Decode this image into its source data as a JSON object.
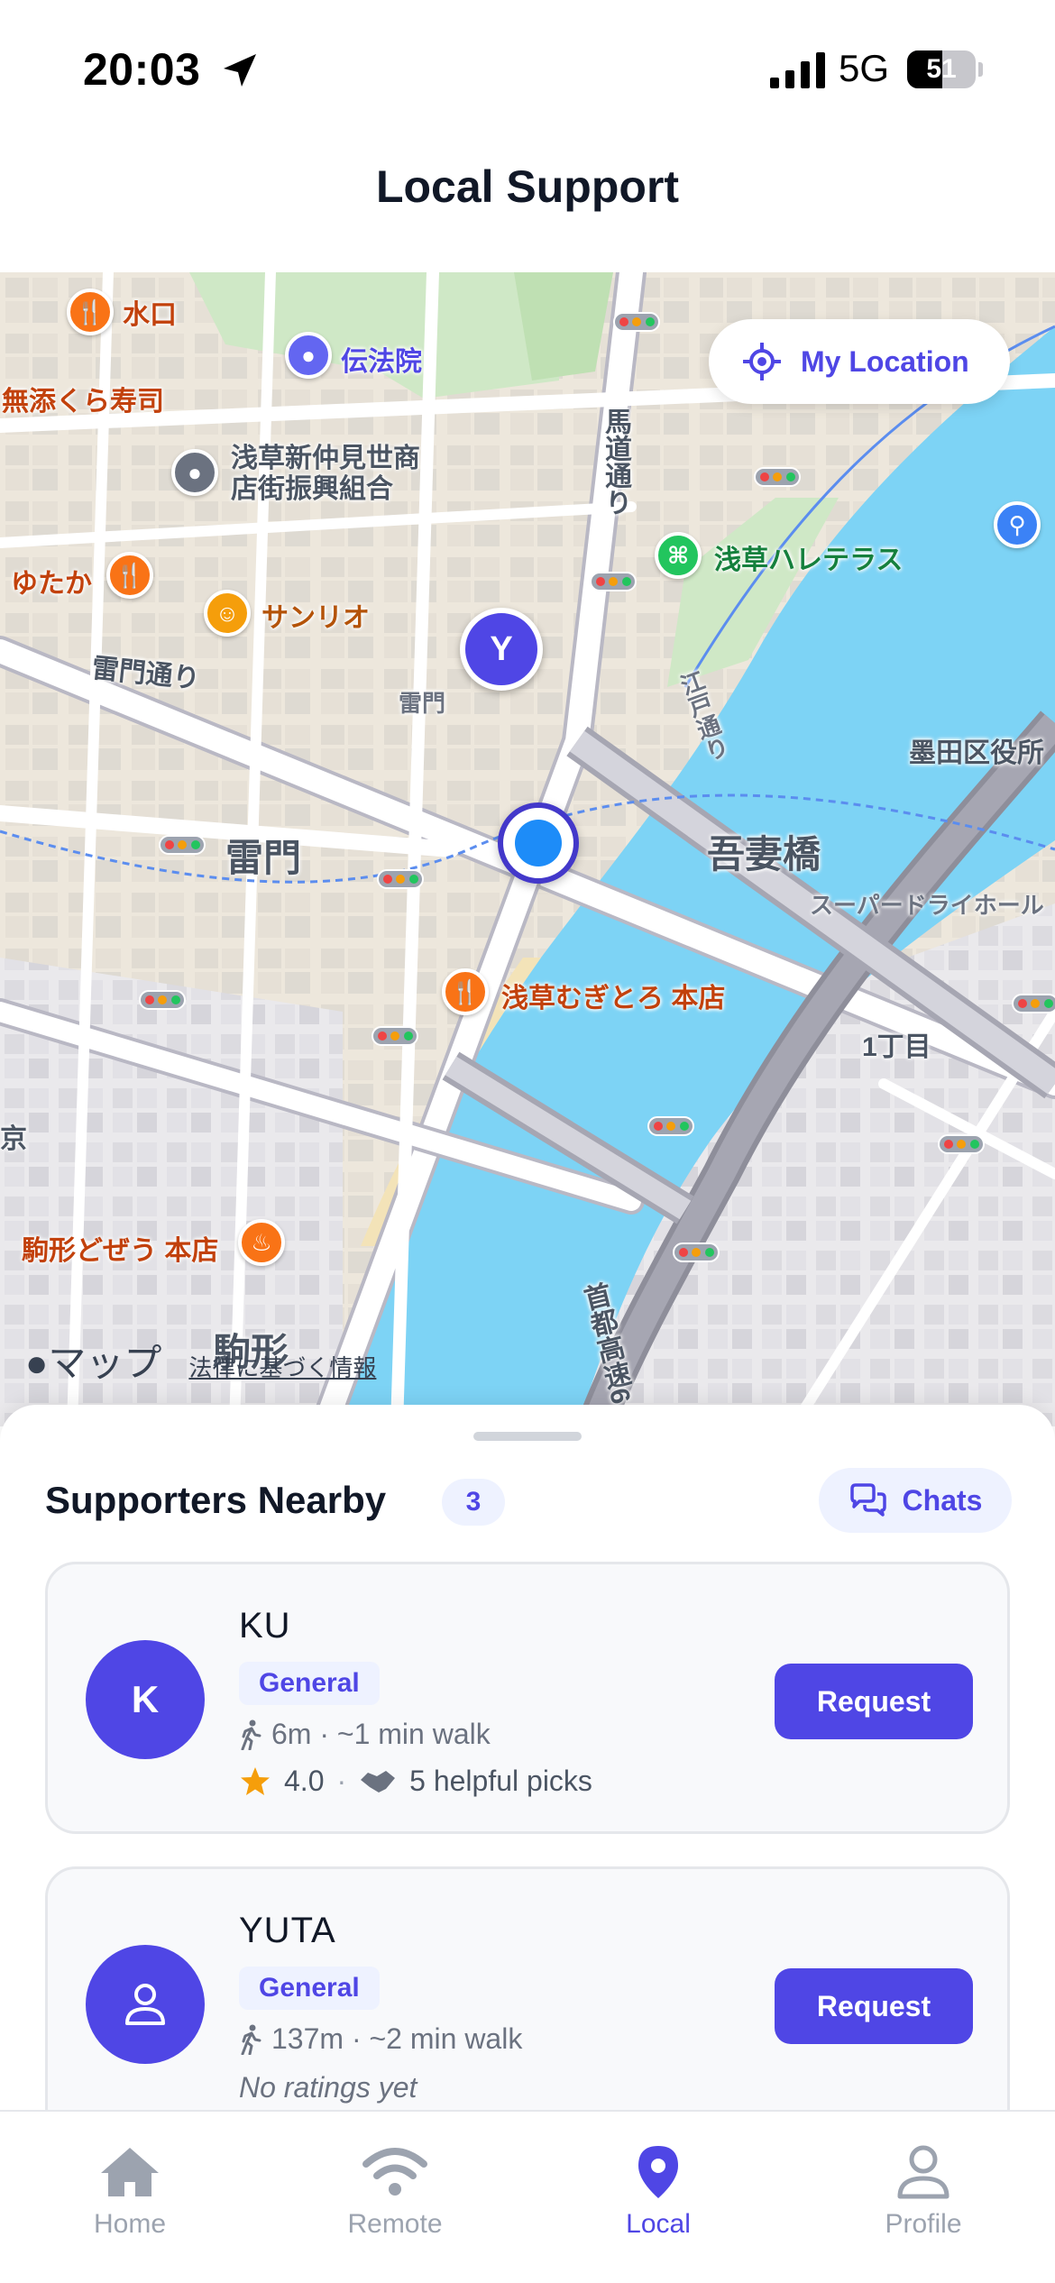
{
  "status_bar": {
    "time": "20:03",
    "network": "5G",
    "battery_label": "51",
    "battery_level": 0.51
  },
  "header": {
    "title": "Local Support"
  },
  "map": {
    "my_location_label": "My Location",
    "user_marker_initial": "Y",
    "poi_labels": {
      "mizuguchi": "水口",
      "denpoin": "伝法院",
      "kura": "無添くら寿司",
      "nakamise": "浅草新仲見世商\n店街振興組合",
      "yutaka": "ゆたか",
      "sanrio": "サンリオ",
      "hale": "浅草ハレテラス",
      "mugitoro": "浅草むぎとろ 本店",
      "komagata_dozeu": "駒形どぜう 本店"
    },
    "area_labels": {
      "kaminarimon_dori": "雷門通り",
      "kaminarimon_small": "雷門",
      "kaminarimon": "雷門",
      "umamichi": "馬道通り",
      "azumabashi": "吾妻橋",
      "sumida_office": "墨田区役所",
      "super_dry_hall": "スーパードライホール",
      "itchome": "1丁目",
      "edo_dori": "江戸通り",
      "shuto": "首都高速6",
      "komagata": "駒形",
      "kyo": "京"
    },
    "attribution_maps": "マップ",
    "attribution_legal": "法律に基づく情報"
  },
  "sheet": {
    "title": "Supporters Nearby",
    "count": "3",
    "chats_label": "Chats"
  },
  "supporters": [
    {
      "initial": "K",
      "name": "KU",
      "tag": "General",
      "distance": "6m · ~1 min walk",
      "rating": "4.0",
      "helpful": "5 helpful picks",
      "button": "Request"
    },
    {
      "name": "YUTA",
      "tag": "General",
      "distance": "137m · ~2 min walk",
      "ratings_note": "No ratings yet",
      "button": "Request"
    }
  ],
  "tabs": [
    {
      "label": "Home",
      "icon": "home-icon"
    },
    {
      "label": "Remote",
      "icon": "wifi-icon"
    },
    {
      "label": "Local",
      "icon": "location-pin-icon",
      "active": true
    },
    {
      "label": "Profile",
      "icon": "person-icon"
    }
  ],
  "colors": {
    "accent": "#4f46e5",
    "accent_light": "#eef2ff",
    "river": "#7dd3f5",
    "text_primary": "#111827",
    "text_muted": "#6b7280"
  }
}
